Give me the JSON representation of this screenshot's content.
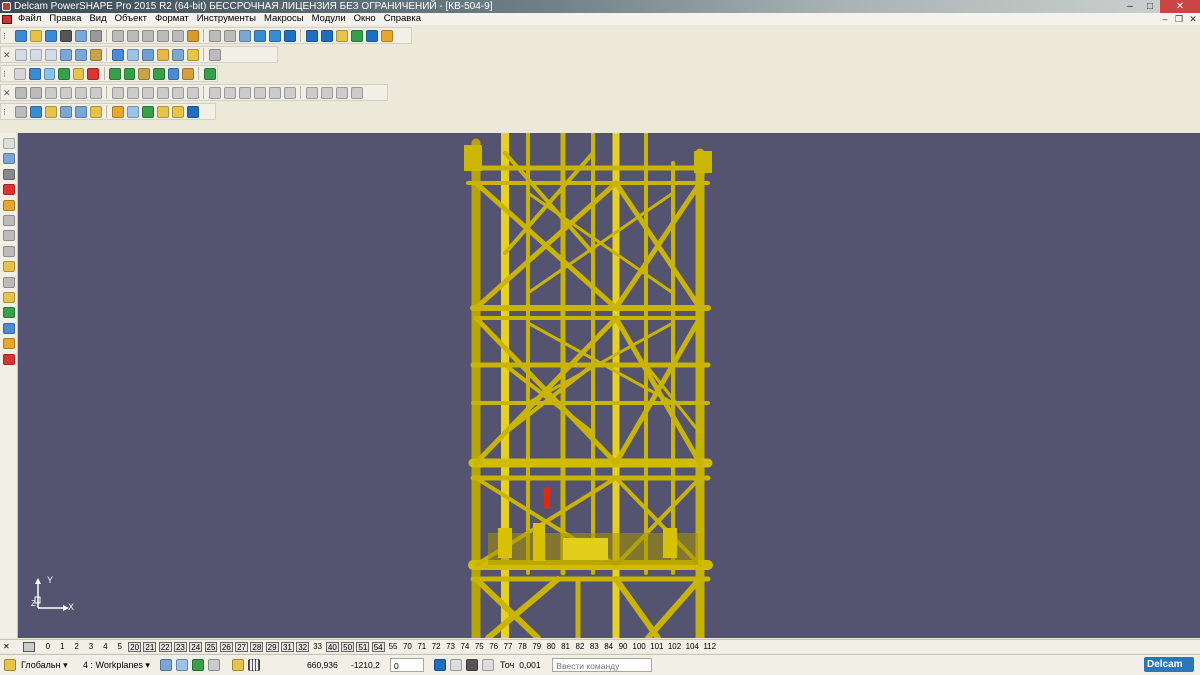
{
  "window": {
    "title": "Delcam PowerSHAPE Pro 2015 R2 (64-bit) БЕССРОЧНАЯ ЛИЦЕНЗИЯ БЕЗ ОГРАНИЧЕНИЙ - [КВ-504-9]",
    "minimize": "–",
    "maximize": "□",
    "close": "✕"
  },
  "menu": [
    "Файл",
    "Правка",
    "Вид",
    "Объект",
    "Формат",
    "Инструменты",
    "Макросы",
    "Модули",
    "Окно",
    "Справка"
  ],
  "mdi": {
    "minimize": "–",
    "restore": "❐",
    "close": "✕"
  },
  "toolbars": [
    {
      "icons": [
        "#3b8ad6",
        "#e8c34a",
        "#3b8ad6",
        "#555",
        "#7aa7d6",
        "#999",
        "#bbb",
        "#bbb",
        "#bbb",
        "#bbb",
        "#bbb",
        "#d69a2a",
        "#bbb",
        "#bbb",
        "#7aa7d6",
        "#3b8ad6",
        "#3b8ad6",
        "#1e6fc2",
        "#1e6fc2",
        "#1e6fc2",
        "#e8c34a",
        "#36a04a",
        "#1e6fc2",
        "#e8a72a"
      ]
    },
    {
      "icons": [
        "#d6dbe8",
        "#d6dbe8",
        "#d6dbe8",
        "#7aa7d6",
        "#7aa7d6",
        "#caa24a",
        "#4a8ad6",
        "#9bc2e8",
        "#6aa0d6",
        "#e8b64a",
        "#7aa7d6",
        "#e8c34a",
        "#bbb"
      ]
    },
    {
      "icons": [
        "#d6d6d6",
        "#3b8ad6",
        "#8bc0e8",
        "#36a04a",
        "#e8c34a",
        "#d33",
        "#36a04a",
        "#36a04a",
        "#caa24a",
        "#36a04a",
        "#4a8ad6",
        "#d6a03a",
        "#36a04a"
      ]
    },
    {
      "icons": [
        "#bbb",
        "#bbb",
        "#ccc",
        "#ccc",
        "#ccc",
        "#ccc",
        "#ccc",
        "#ccc",
        "#ccc",
        "#ccc",
        "#ccc",
        "#ccc",
        "#ccc",
        "#ccc",
        "#ccc",
        "#ccc",
        "#ccc",
        "#ccc",
        "#ccc",
        "#ccc",
        "#ccc",
        "#ccc"
      ]
    },
    {
      "icons": [
        "#bbb",
        "#3b8ad6",
        "#e8c34a",
        "#7aa7d6",
        "#7aa7d6",
        "#e8c34a",
        "#e8a72a",
        "#9bc2e8",
        "#36a04a",
        "#e8c34a",
        "#e8c34a",
        "#1e6fc2"
      ]
    }
  ],
  "left_tools": [
    "#ddd",
    "#7aa7d6",
    "#888",
    "#d33",
    "#e8a72a",
    "#bbb",
    "#bbb",
    "#bbb",
    "#e8c34a",
    "#bbb",
    "#e8c34a",
    "#36a04a",
    "#4a8ad6",
    "#e8a72a",
    "#d33"
  ],
  "axes": {
    "y": "Y",
    "x": "X",
    "z": "Z"
  },
  "levels": [
    {
      "n": "0",
      "on": false
    },
    {
      "n": "1",
      "on": false
    },
    {
      "n": "2",
      "on": false
    },
    {
      "n": "3",
      "on": false
    },
    {
      "n": "4",
      "on": false
    },
    {
      "n": "5",
      "on": false
    },
    {
      "n": "20",
      "on": true
    },
    {
      "n": "21",
      "on": true
    },
    {
      "n": "22",
      "on": true
    },
    {
      "n": "23",
      "on": true
    },
    {
      "n": "24",
      "on": true
    },
    {
      "n": "25",
      "on": true
    },
    {
      "n": "26",
      "on": true
    },
    {
      "n": "27",
      "on": true
    },
    {
      "n": "28",
      "on": true
    },
    {
      "n": "29",
      "on": true
    },
    {
      "n": "31",
      "on": true
    },
    {
      "n": "32",
      "on": true
    },
    {
      "n": "33",
      "on": false
    },
    {
      "n": "40",
      "on": true
    },
    {
      "n": "50",
      "on": true
    },
    {
      "n": "51",
      "on": true
    },
    {
      "n": "54",
      "on": true
    },
    {
      "n": "55",
      "on": false
    },
    {
      "n": "70",
      "on": false
    },
    {
      "n": "71",
      "on": false
    },
    {
      "n": "72",
      "on": false
    },
    {
      "n": "73",
      "on": false
    },
    {
      "n": "74",
      "on": false
    },
    {
      "n": "75",
      "on": false
    },
    {
      "n": "76",
      "on": false
    },
    {
      "n": "77",
      "on": false
    },
    {
      "n": "78",
      "on": false
    },
    {
      "n": "79",
      "on": false
    },
    {
      "n": "80",
      "on": false
    },
    {
      "n": "81",
      "on": false
    },
    {
      "n": "82",
      "on": false
    },
    {
      "n": "83",
      "on": false
    },
    {
      "n": "84",
      "on": false
    },
    {
      "n": "90",
      "on": false
    },
    {
      "n": "100",
      "on": false
    },
    {
      "n": "101",
      "on": false
    },
    {
      "n": "102",
      "on": false
    },
    {
      "n": "104",
      "on": false
    },
    {
      "n": "112",
      "on": false
    }
  ],
  "status": {
    "coord_system": "Глобальн",
    "workplane_num": "4",
    "workplane": ": Workplanes",
    "x": "660,936",
    "y": "-1210,2",
    "z": "0",
    "tol_label": "Точ",
    "tol": "0,001",
    "command_placeholder": "Ввести команду",
    "logo": "Delcam"
  },
  "colors": {
    "viewport": "#545370",
    "model": "#d8c200",
    "model_light": "#f0dc22",
    "model_dark": "#8a7a00",
    "pin": "#e02a10"
  }
}
